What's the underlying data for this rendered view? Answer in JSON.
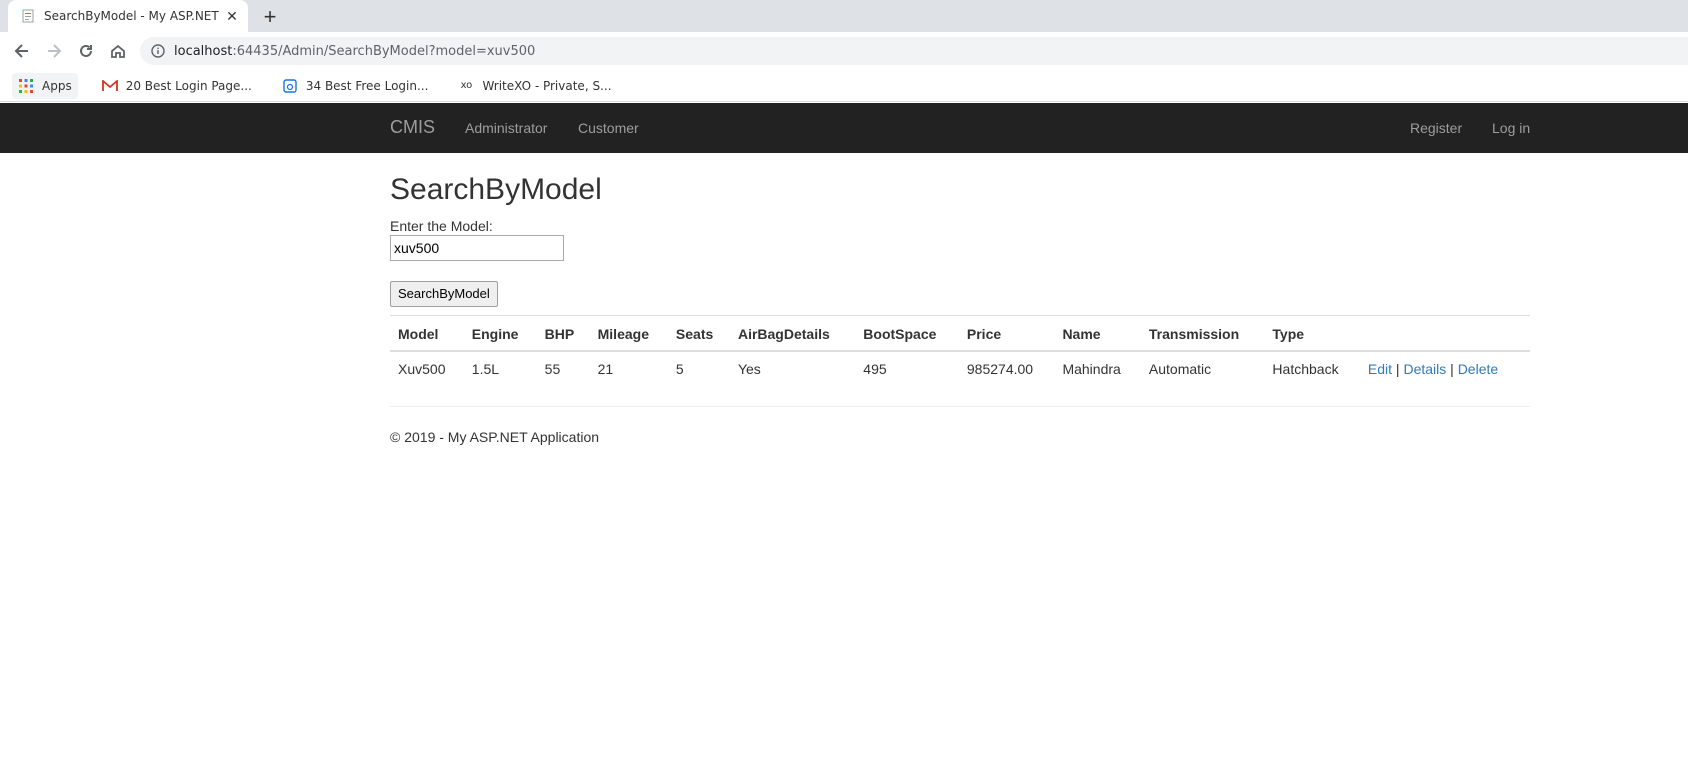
{
  "browser": {
    "tab_title": "SearchByModel - My ASP.NET Application",
    "tab_close": "✕",
    "new_tab": "+",
    "url_host": "localhost",
    "url_path": ":64435/Admin/SearchByModel?model=xuv500",
    "bookmarks": [
      {
        "label": "Apps",
        "icon": "apps-grid-icon"
      },
      {
        "label": "20 Best Login Page...",
        "icon": "gmail-icon"
      },
      {
        "label": "34 Best Free Login...",
        "icon": "bookmark-page-icon"
      },
      {
        "label": "WriteXO - Private, S...",
        "icon": "xo-icon",
        "icon_text": "xo"
      }
    ]
  },
  "nav": {
    "brand": "CMIS",
    "links": [
      "Administrator",
      "Customer"
    ],
    "right_links": [
      "Register",
      "Log in"
    ]
  },
  "page": {
    "title": "SearchByModel",
    "input_label": "Enter the Model:",
    "input_value": "xuv500",
    "button_label": "SearchByModel"
  },
  "table": {
    "headers": [
      "Model",
      "Engine",
      "BHP",
      "Mileage",
      "Seats",
      "AirBagDetails",
      "BootSpace",
      "Price",
      "Name",
      "Transmission",
      "Type"
    ],
    "rows": [
      {
        "cells": [
          "Xuv500",
          "1.5L",
          "55",
          "21",
          "5",
          "Yes",
          "495",
          "985274.00",
          "Mahindra",
          "Automatic",
          "Hatchback"
        ],
        "actions": {
          "edit": "Edit",
          "details": "Details",
          "delete": "Delete",
          "separator": " | "
        }
      }
    ]
  },
  "footer": {
    "text": "© 2019 - My ASP.NET Application"
  },
  "colors": {
    "navbar_bg": "#222222",
    "nav_link": "#9d9d9d",
    "link": "#337ab7"
  }
}
